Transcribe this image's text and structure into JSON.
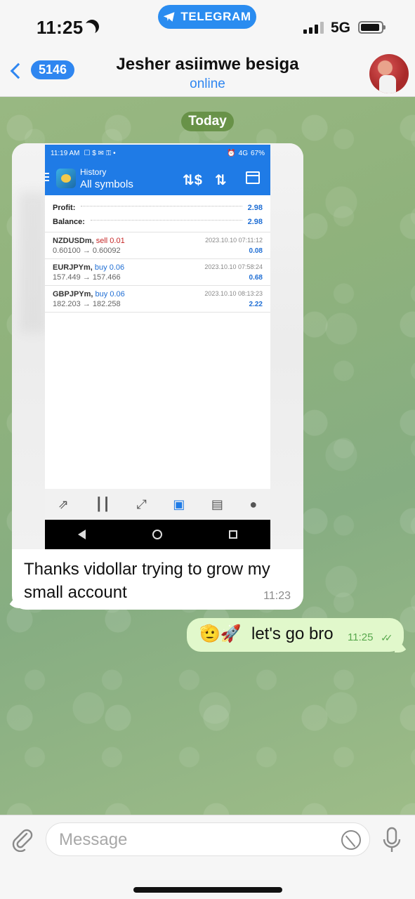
{
  "status_bar": {
    "time": "11:25",
    "app_pill": "TELEGRAM",
    "network": "5G"
  },
  "header": {
    "back_count": "5146",
    "contact_name": "Jesher asiimwe besiga",
    "status": "online"
  },
  "date_separator": "Today",
  "incoming": {
    "screenshot": {
      "status_time": "11:19 AM",
      "status_right": "4G",
      "battery": "67%",
      "title_small": "History",
      "title_big": "All symbols",
      "summary": [
        {
          "label": "Profit:",
          "value": "2.98"
        },
        {
          "label": "Balance:",
          "value": "2.98"
        }
      ],
      "trades": [
        {
          "symbol": "NZDUSDm,",
          "side": "sell 0.01",
          "side_type": "sell",
          "prices": "0.60100 → 0.60092",
          "date": "2023.10.10 07:11:12",
          "profit": "0.08"
        },
        {
          "symbol": "EURJPYm,",
          "side": "buy 0.06",
          "side_type": "buy",
          "prices": "157.449 → 157.466",
          "date": "2023.10.10 07:58:24",
          "profit": "0.68"
        },
        {
          "symbol": "GBPJPYm,",
          "side": "buy 0.06",
          "side_type": "buy",
          "prices": "182.203 → 182.258",
          "date": "2023.10.10 08:13:23",
          "profit": "2.22"
        }
      ]
    },
    "text": "Thanks vidollar trying to grow my small account",
    "time": "11:23"
  },
  "outgoing": {
    "emoji": "🫡🚀",
    "text": "let's go bro",
    "time": "11:25"
  },
  "input": {
    "placeholder": "Message"
  },
  "colors": {
    "accent": "#2f86f0",
    "outgoing_bubble": "#e1f8cb",
    "chart_buy": "#1f6ed4",
    "chart_sell": "#c62828"
  }
}
